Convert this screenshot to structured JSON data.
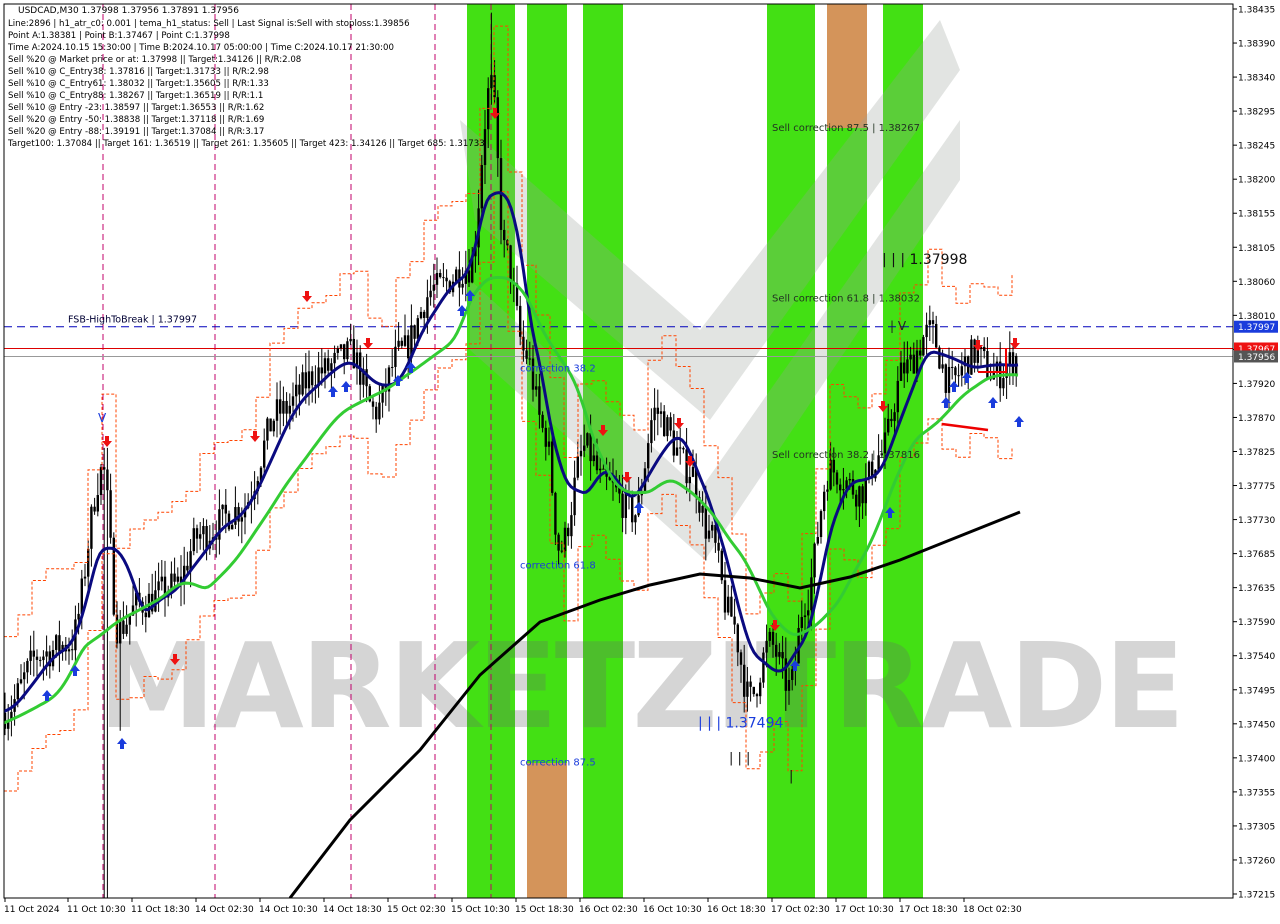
{
  "header": {
    "title": "USDCAD,M30  1.37998 1.37956 1.37891 1.37956",
    "info_lines": [
      "Line:2896 | h1_atr_c0: 0.001 | tema_h1_status: Sell | Last Signal is:Sell with stoploss:1.39856",
      "Point A:1.38381 | Point B:1.37467 | Point C:1.37998",
      "Time A:2024.10.15 15:30:00 | Time B:2024.10.17 05:00:00 | Time C:2024.10.17 21:30:00",
      "Sell %20 @ Market price or at: 1.37998 || Target:1.34126 || R/R:2.08",
      "Sell %10 @ C_Entry38: 1.37816 || Target:1.31733 || R/R:2.98",
      "Sell %10 @ C_Entry61: 1.38032 || Target:1.35605 || R/R:1.33",
      "Sell %10 @ C_Entry88: 1.38267 || Target:1.36519 || R/R:1.1",
      "Sell %10 @ Entry -23: 1.38597 || Target:1.36553 || R/R:1.62",
      "Sell %20 @ Entry -50: 1.38838 || Target:1.37118 || R/R:1.69",
      "Sell %20 @ Entry -88: 1.39191 || Target:1.37084 || R/R:3.17",
      "Target100: 1.37084 || Target 161: 1.36519 || Target 261: 1.35605 || Target 423: 1.34126 || Target 685: 1.31733"
    ]
  },
  "watermark": "MARKETZITRADE",
  "colors": {
    "green_zone": "#33dd00",
    "orange_zone": "#d4945a",
    "fast_ma": "#0a0a80",
    "mid_ma": "#33cc33",
    "slow_ma": "#000000",
    "orange_band": "#ff4400",
    "pink_line": "#c0006a",
    "red_line": "#dd0000",
    "blue_dashed": "#0000bb",
    "buy_arrow": "#1a3cdc",
    "sell_arrow": "#ee1111",
    "current_price_bg": "#555555",
    "resistance_bg": "#1a3cdc"
  },
  "chart_data": {
    "type": "candlestick",
    "symbol": "USDCAD",
    "timeframe": "M30",
    "ylim": [
      1.37215,
      1.38435
    ],
    "y_ticks": [
      "1.38435",
      "1.38390",
      "1.38340",
      "1.38295",
      "1.38245",
      "1.38200",
      "1.38155",
      "1.38105",
      "1.38060",
      "1.38010",
      "1.37965",
      "1.37920",
      "1.37870",
      "1.37825",
      "1.37775",
      "1.37730",
      "1.37685",
      "1.37635",
      "1.37590",
      "1.37540",
      "1.37495",
      "1.37450",
      "1.37400",
      "1.37355",
      "1.37305",
      "1.37260",
      "1.37215"
    ],
    "x_labels": [
      "11 Oct 2024",
      "11 Oct 10:30",
      "11 Oct 18:30",
      "14 Oct 02:30",
      "14 Oct 10:30",
      "14 Oct 18:30",
      "15 Oct 02:30",
      "15 Oct 10:30",
      "15 Oct 18:30",
      "16 Oct 02:30",
      "16 Oct 10:30",
      "16 Oct 18:30",
      "17 Oct 02:30",
      "17 Oct 10:30",
      "17 Oct 18:30",
      "18 Oct 02:30"
    ],
    "price_tags": [
      {
        "label": "1.37997",
        "value": 1.37997,
        "kind": "resistance"
      },
      {
        "label": "1.37967",
        "value": 1.37967,
        "kind": "stop"
      },
      {
        "label": "1.37956",
        "value": 1.37956,
        "kind": "current"
      }
    ],
    "horizontal_lines": [
      {
        "label": "FSB-HighToBreak | 1.37997",
        "value": 1.37997,
        "style": "dashed"
      },
      {
        "label": "",
        "value": 1.37967,
        "style": "solid-red"
      },
      {
        "label": "",
        "value": 1.37956,
        "style": "solid-gray"
      }
    ],
    "zone_labels": [
      {
        "text": "Sell correction 87.5 | 1.38267",
        "value": 1.38267
      },
      {
        "text": "Sell correction 61.8 | 1.38032",
        "value": 1.38032
      },
      {
        "text": "Sell correction 38.2 | 1.37816",
        "value": 1.37816
      },
      {
        "text": "correction 38.2",
        "value": 1.37935
      },
      {
        "text": "correction 61.8",
        "value": 1.37664
      },
      {
        "text": "correction 87.5",
        "value": 1.37392
      }
    ],
    "point_labels": [
      {
        "text": "| | | 1.37998",
        "value": 1.38089
      },
      {
        "text": "| | | 1.37494",
        "value": 1.3745
      }
    ]
  }
}
